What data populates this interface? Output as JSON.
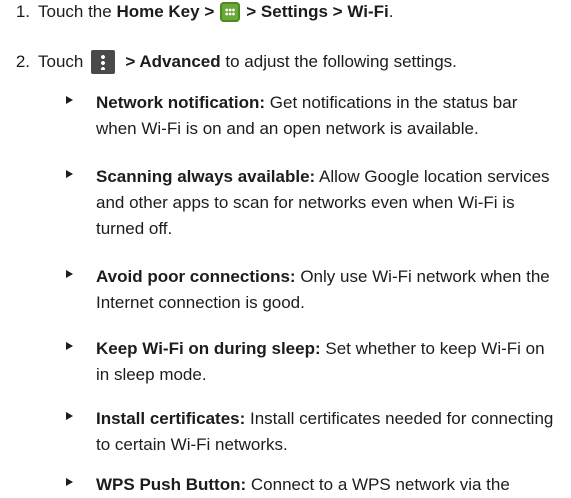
{
  "steps": [
    {
      "num": "1.",
      "pre": "Touch the ",
      "b1": "Home Key >",
      "b2": " > Settings > Wi-Fi",
      "post": "."
    },
    {
      "num": "2.",
      "pre": "Touch ",
      "b1": "> Advanced",
      "post": " to adjust the following settings."
    }
  ],
  "icons": {
    "apps": "apps-grid-icon",
    "menu": "overflow-menu-icon"
  },
  "items": [
    {
      "term": "Network notification:",
      "desc": " Get notifications in the status bar when Wi-Fi is on and an open network is available."
    },
    {
      "term": "Scanning always available:",
      "desc": " Allow Google location services and other apps to scan for networks even when Wi-Fi is turned off."
    },
    {
      "term": "Avoid poor connections:",
      "desc": " Only use Wi-Fi network when the Internet connection is good."
    },
    {
      "term": "Keep Wi-Fi on during sleep:",
      "desc": " Set whether to keep Wi-Fi on in sleep mode."
    },
    {
      "term": "Install certificates:",
      "desc": " Install certificates needed for connecting to certain Wi-Fi networks."
    },
    {
      "term": "WPS Push Button:",
      "desc": " Connect to a WPS network via the"
    }
  ]
}
